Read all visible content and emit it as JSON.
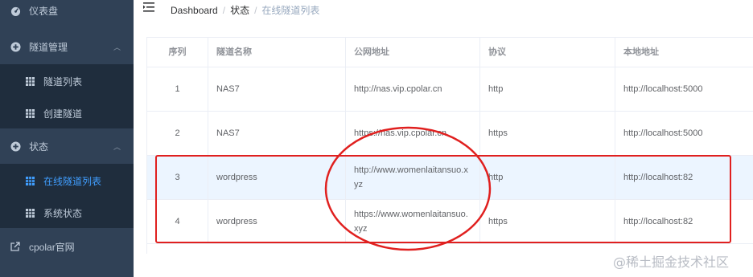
{
  "sidebar": {
    "dashboard": "仪表盘",
    "tunnel_mgmt": "隧道管理",
    "tunnel_list": "隧道列表",
    "create_tunnel": "创建隧道",
    "status": "状态",
    "online_tunnels": "在线隧道列表",
    "system_status": "系统状态",
    "cpolar_site": "cpolar官网"
  },
  "breadcrumb": {
    "home": "Dashboard",
    "level1": "状态",
    "sep": "/",
    "current": "在线隧道列表"
  },
  "table": {
    "headers": [
      "序列",
      "隧道名称",
      "公网地址",
      "协议",
      "本地地址"
    ],
    "rows": [
      {
        "index": "1",
        "name": "NAS7",
        "public": "http://nas.vip.cpolar.cn",
        "protocol": "http",
        "local": "http://localhost:5000"
      },
      {
        "index": "2",
        "name": "NAS7",
        "public": "https://nas.vip.cpolar.cn",
        "protocol": "https",
        "local": "http://localhost:5000"
      },
      {
        "index": "3",
        "name": "wordpress",
        "public": "http://www.womenlaitansuo.xyz",
        "protocol": "http",
        "local": "http://localhost:82"
      },
      {
        "index": "4",
        "name": "wordpress",
        "public": "https://www.womenlaitansuo.xyz",
        "protocol": "https",
        "local": "http://localhost:82"
      }
    ]
  },
  "watermark": "@稀土掘金技术社区",
  "colors": {
    "sidebar_bg": "#304156",
    "submenu_bg": "#1f2d3d",
    "active": "#409eff",
    "annotation_red": "#e0201f"
  }
}
